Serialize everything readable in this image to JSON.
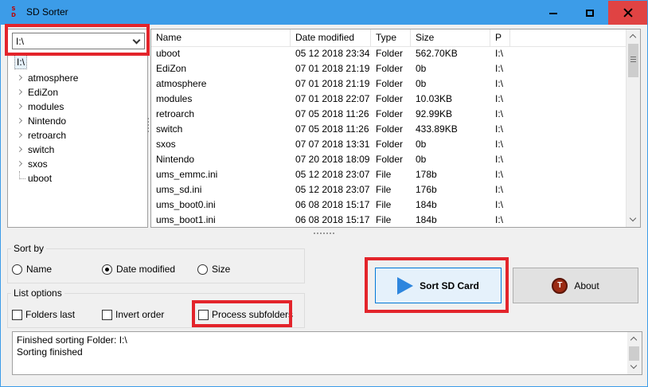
{
  "window": {
    "title": "SD Sorter",
    "app_icon": "sd-sorter-icon"
  },
  "drive_select": {
    "value": "I:\\"
  },
  "tree": {
    "root": "I:\\",
    "items": [
      {
        "label": "atmosphere",
        "expandable": true
      },
      {
        "label": "EdiZon",
        "expandable": true
      },
      {
        "label": "modules",
        "expandable": true
      },
      {
        "label": "Nintendo",
        "expandable": true
      },
      {
        "label": "retroarch",
        "expandable": true
      },
      {
        "label": "switch",
        "expandable": true
      },
      {
        "label": "sxos",
        "expandable": true
      },
      {
        "label": "uboot",
        "expandable": false
      }
    ]
  },
  "file_list": {
    "columns": [
      "Name",
      "Date modified",
      "Type",
      "Size",
      "P"
    ],
    "rows": [
      [
        "uboot",
        "05 12 2018 23:34",
        "Folder",
        "562.70KB",
        "I:\\"
      ],
      [
        "EdiZon",
        "07 01 2018 21:19",
        "Folder",
        "0b",
        "I:\\"
      ],
      [
        "atmosphere",
        "07 01 2018 21:19",
        "Folder",
        "0b",
        "I:\\"
      ],
      [
        "modules",
        "07 01 2018 22:07",
        "Folder",
        "10.03KB",
        "I:\\"
      ],
      [
        "retroarch",
        "07 05 2018 11:26",
        "Folder",
        "92.99KB",
        "I:\\"
      ],
      [
        "switch",
        "07 05 2018 11:26",
        "Folder",
        "433.89KB",
        "I:\\"
      ],
      [
        "sxos",
        "07 07 2018 13:31",
        "Folder",
        "0b",
        "I:\\"
      ],
      [
        "Nintendo",
        "07 20 2018 18:09",
        "Folder",
        "0b",
        "I:\\"
      ],
      [
        "ums_emmc.ini",
        "05 12 2018 23:07",
        "File",
        "178b",
        "I:\\"
      ],
      [
        "ums_sd.ini",
        "05 12 2018 23:07",
        "File",
        "176b",
        "I:\\"
      ],
      [
        "ums_boot0.ini",
        "06 08 2018 15:17",
        "File",
        "184b",
        "I:\\"
      ],
      [
        "ums_boot1.ini",
        "06 08 2018 15:17",
        "File",
        "184b",
        "I:\\"
      ]
    ]
  },
  "sort_by": {
    "label": "Sort by",
    "options": [
      {
        "label": "Name",
        "selected": false
      },
      {
        "label": "Date modified",
        "selected": true
      },
      {
        "label": "Size",
        "selected": false
      }
    ]
  },
  "list_options": {
    "label": "List options",
    "folders_last": {
      "label": "Folders last",
      "checked": false
    },
    "invert_order": {
      "label": "Invert order",
      "checked": false
    },
    "process_subfolders": {
      "label": "Process subfolders",
      "checked": false
    }
  },
  "buttons": {
    "sort": {
      "label": "Sort SD Card",
      "icon": "play-icon"
    },
    "about": {
      "label": "About",
      "icon": "about-logo-icon"
    }
  },
  "log": {
    "lines": [
      "Finished sorting Folder: I:\\",
      "Sorting finished"
    ]
  },
  "colors": {
    "titlebar": "#3c9ce8",
    "close_button": "#e04343",
    "highlight": "#e3242b",
    "accent": "#0078d7"
  }
}
